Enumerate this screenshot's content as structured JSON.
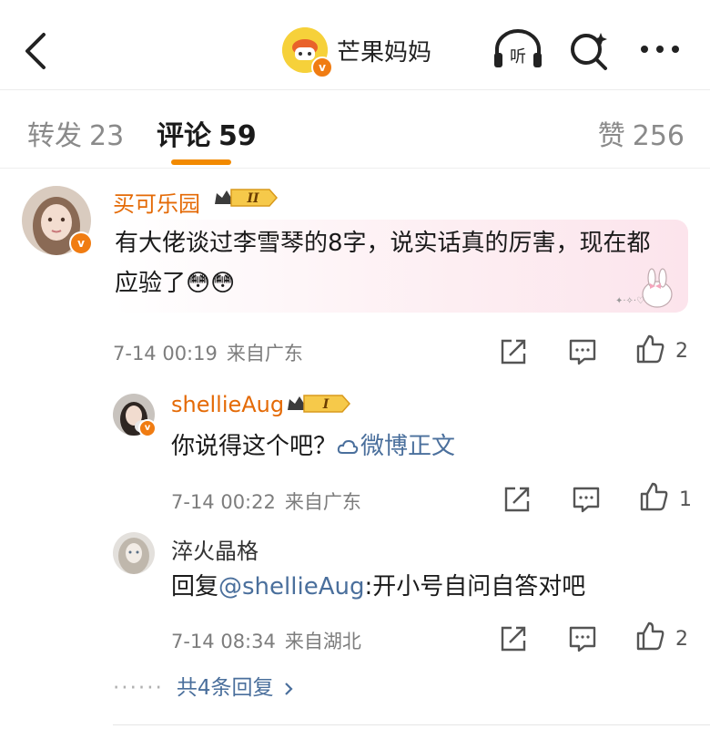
{
  "header": {
    "account_name": "芒果妈妈",
    "icons": {
      "back": "back-chevron-icon",
      "listen": "listen-headphones-icon",
      "search": "search-sparkle-icon",
      "more": "more-dots-icon"
    },
    "listen_label": "听"
  },
  "tabs": [
    {
      "label": "转发",
      "count": "23"
    },
    {
      "label": "评论",
      "count": "59",
      "active": true
    },
    {
      "label": "赞",
      "count": "256"
    }
  ],
  "accent_color": "#f28a00",
  "comments": [
    {
      "user": "买可乐园",
      "rank": "II",
      "verified": true,
      "text": "有大佬谈过李雪琴的8字，说实话真的厉害，现在都应验了😳😳",
      "time": "7-14 00:19",
      "location": "来自广东",
      "likes": "2"
    }
  ],
  "replies": [
    {
      "user": "shellieAug",
      "rank": "I",
      "verified": true,
      "text_prefix": "你说得这个吧？",
      "link_text": "微博正文",
      "time": "7-14 00:22",
      "location": "来自广东",
      "likes": "1"
    },
    {
      "user": "淬火晶格",
      "reply_prefix": "回复",
      "mention": "@shellieAug",
      "text": ":开小号自问自答对吧",
      "time": "7-14 08:34",
      "location": "来自湖北",
      "likes": "2"
    }
  ],
  "more_replies": "共4条回复"
}
